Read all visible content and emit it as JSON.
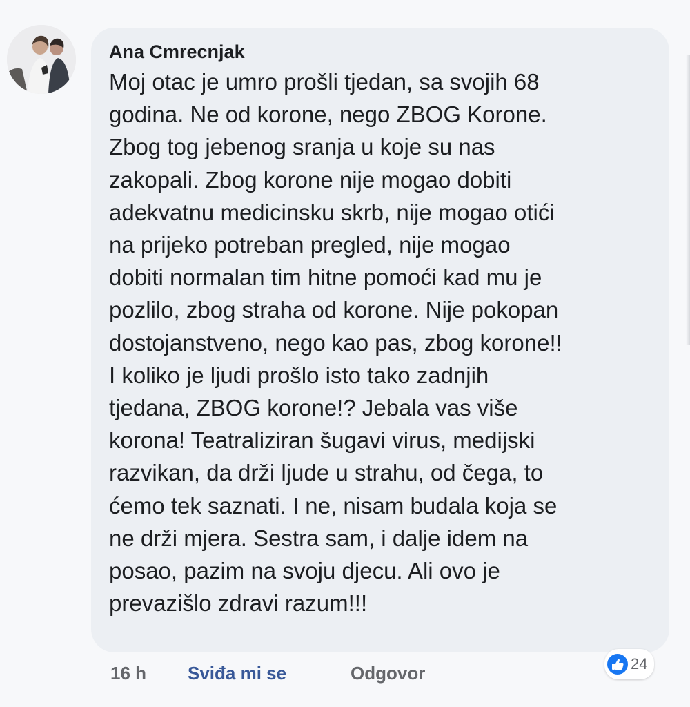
{
  "comment": {
    "author": "Ana Cmrecnjak",
    "lines": [
      "Moj otac je umro prošli tjedan, sa svojih 68",
      "godina. Ne od korone, nego ZBOG Korone.",
      "Zbog tog jebenog sranja u koje su nas",
      "zakopali. Zbog korone nije mogao dobiti",
      "adekvatnu medicinsku skrb, nije mogao otići",
      "na prijeko potreban pregled, nije mogao",
      "dobiti normalan tim hitne pomoći kad mu je",
      "pozlilo, zbog straha od korone. Nije pokopan",
      "dostojanstveno, nego kao pas, zbog korone!!",
      "I koliko je ljudi prošlo isto tako zadnjih",
      "tjedana, ZBOG korone!? Jebala vas više",
      "korona! Teatraliziran šugavi virus, medijski",
      "razvikan, da drži ljude u strahu, od čega, to",
      "ćemo tek saznati. I ne, nisam budala koja se",
      "ne drži mjera. Sestra sam, i dalje idem na",
      "posao, pazim na svoju djecu. Ali ovo je",
      "prevazišlo zdravi razum!!!"
    ]
  },
  "actions": {
    "time": "16 h",
    "like_label": "Sviđa mi se",
    "reply_label": "Odgovor"
  },
  "reactions": {
    "icon": "thumbs-up-icon",
    "count": "24",
    "color": "#1877f2"
  }
}
